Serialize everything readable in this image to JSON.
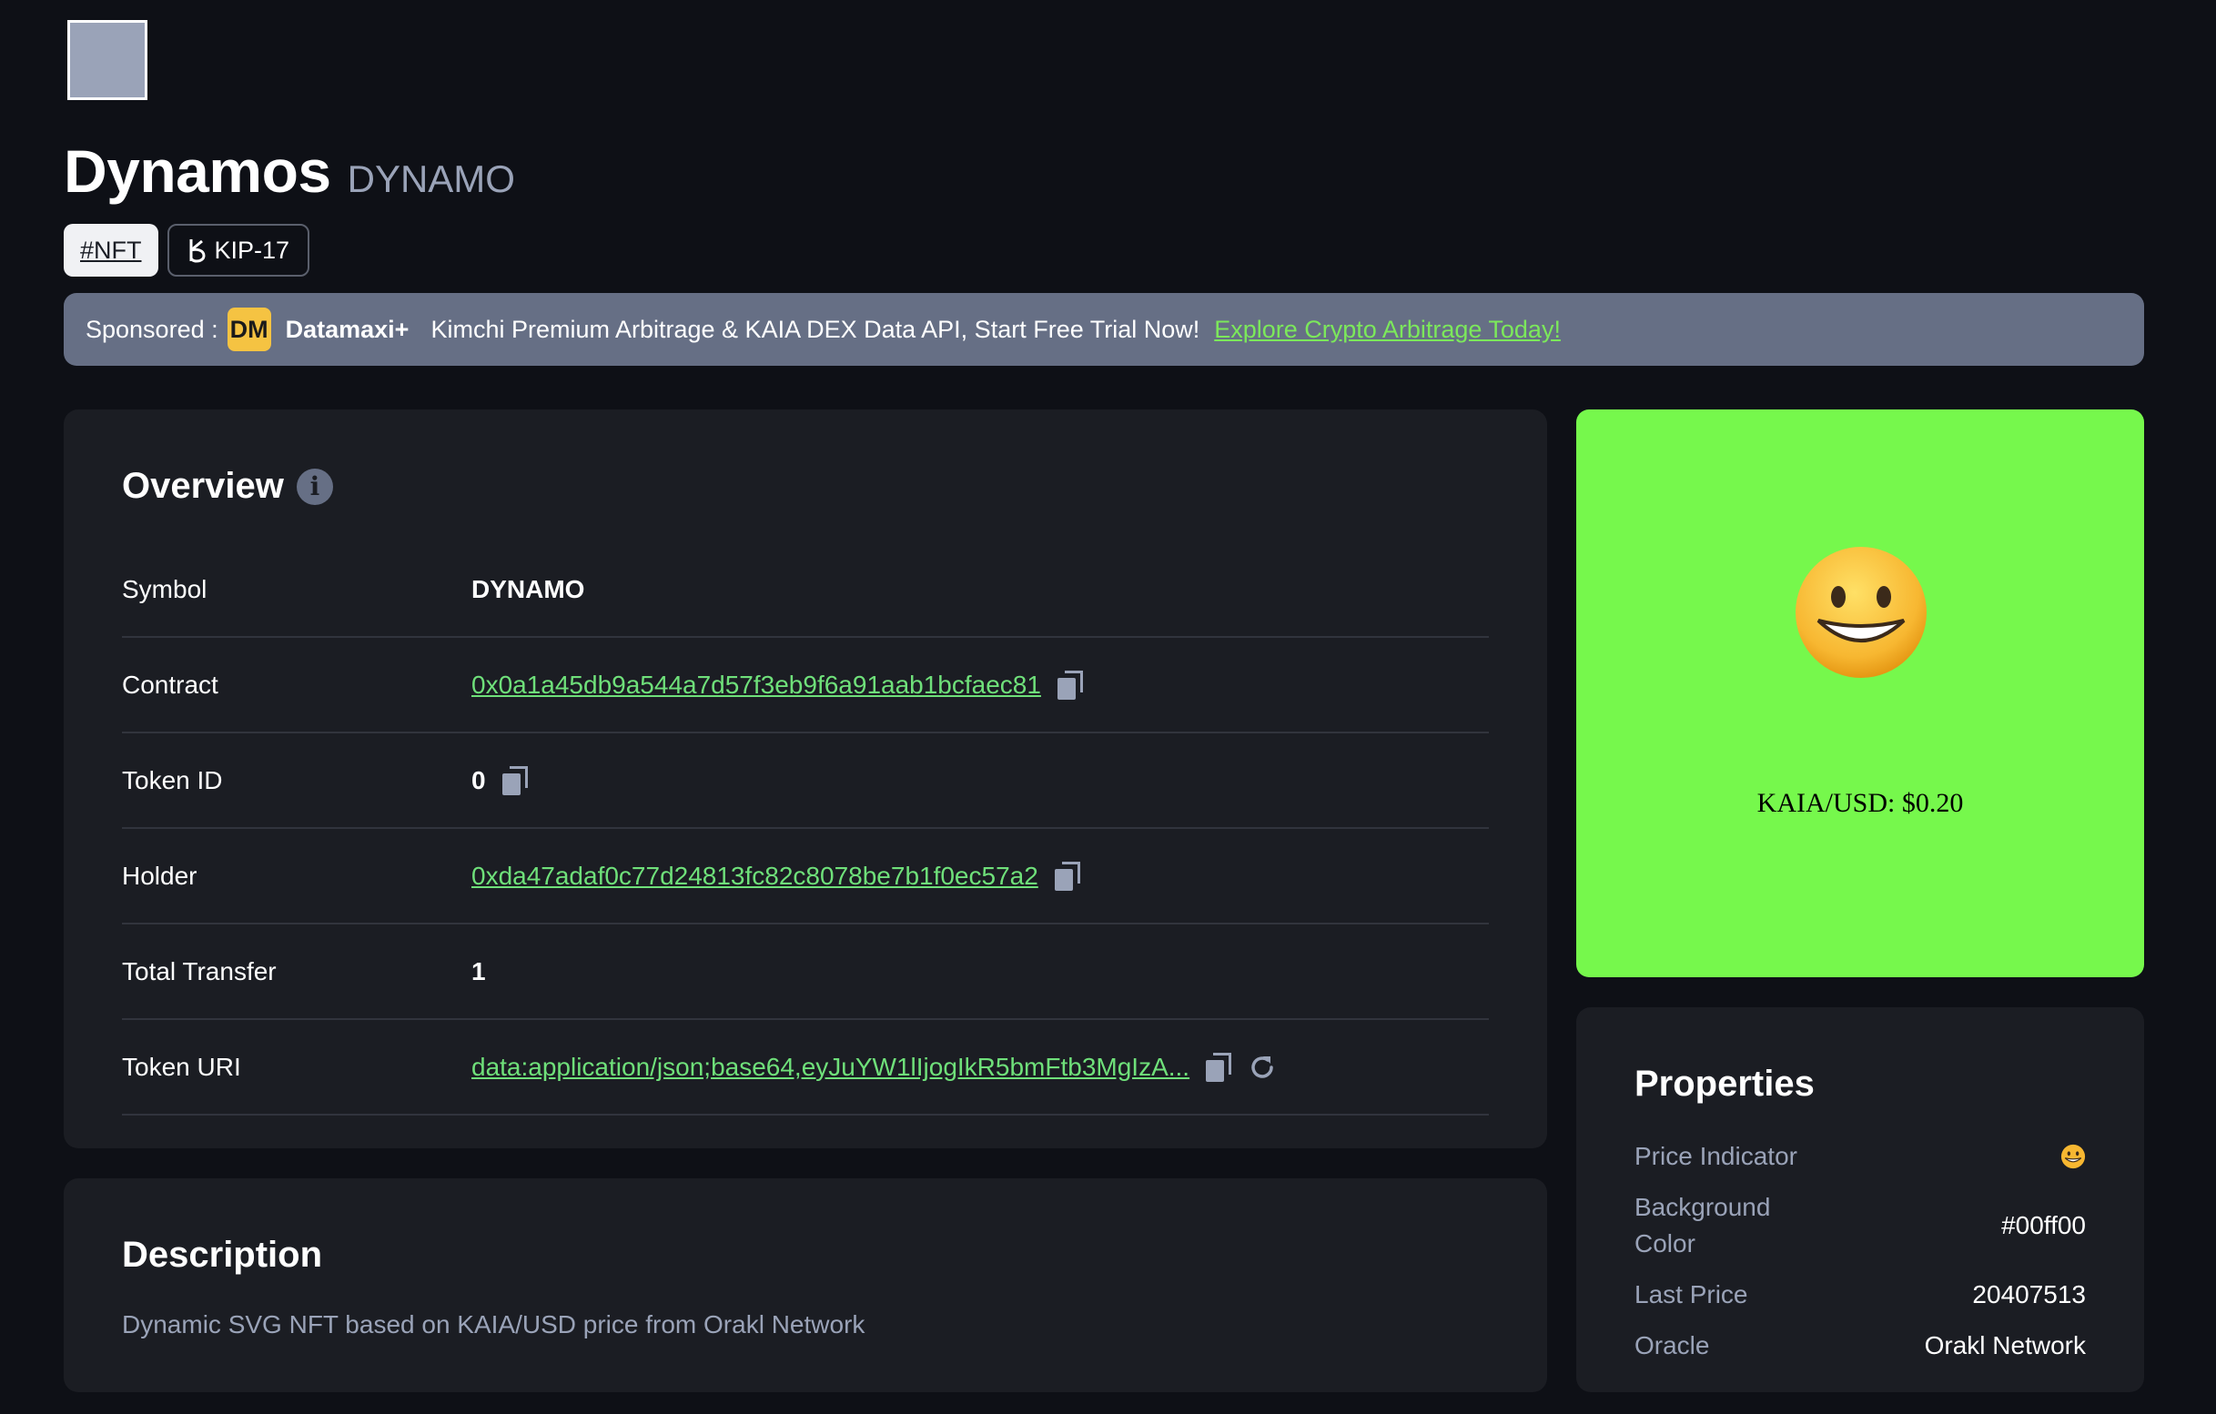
{
  "header": {
    "title": "Dynamos",
    "symbol": "DYNAMO"
  },
  "tags": {
    "nft": "#NFT",
    "kip": "KIP-17"
  },
  "sponsor": {
    "prefix": "Sponsored :",
    "badge": "DM",
    "brand": "Datamaxi+",
    "text": "Kimchi Premium Arbitrage & KAIA DEX Data API, Start Free Trial Now!",
    "link": "Explore Crypto Arbitrage Today!"
  },
  "overview": {
    "title": "Overview",
    "rows": [
      {
        "label": "Symbol",
        "value": "DYNAMO"
      },
      {
        "label": "Contract",
        "value": "0x0a1a45db9a544a7d57f3eb9f6a91aab1bcfaec81"
      },
      {
        "label": "Token ID",
        "value": "0"
      },
      {
        "label": "Holder",
        "value": "0xda47adaf0c77d24813fc82c8078be7b1f0ec57a2"
      },
      {
        "label": "Total Transfer",
        "value": "1"
      },
      {
        "label": "Token URI",
        "value": "data:application/json;base64,eyJuYW1lIjogIkR5bmFtb3MgIzA..."
      }
    ]
  },
  "description": {
    "title": "Description",
    "text": "Dynamic SVG NFT based on KAIA/USD price from Orakl Network"
  },
  "preview": {
    "price_text": "KAIA/USD: $0.20",
    "background": "#76f84c"
  },
  "properties": {
    "title": "Properties",
    "items": [
      {
        "label": "Price Indicator",
        "value": ""
      },
      {
        "label": "Background Color",
        "value": "#00ff00"
      },
      {
        "label": "Last Price",
        "value": "20407513"
      },
      {
        "label": "Oracle",
        "value": "Orakl Network"
      }
    ]
  },
  "colors": {
    "accent_green": "#6fe07a",
    "page_bg": "#0e1016",
    "panel_bg": "#1b1d23"
  }
}
